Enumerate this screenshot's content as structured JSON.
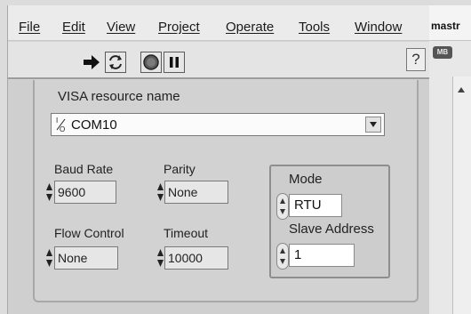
{
  "menu": {
    "file": "File",
    "edit": "Edit",
    "view": "View",
    "project": "Project",
    "operate": "Operate",
    "tools": "Tools",
    "window": "Window"
  },
  "toolbar": {
    "run_icon": "run-arrow-icon",
    "run_continuous_icon": "run-continuously-icon",
    "abort_icon": "abort-execution-icon",
    "pause_icon": "pause-icon",
    "help_label": "?"
  },
  "side_panel": {
    "title": "mastr",
    "badge": "MB"
  },
  "visa": {
    "label": "VISA resource name",
    "prefix": "I/O",
    "value": "COM10"
  },
  "baud_rate": {
    "label": "Baud Rate",
    "value": "9600"
  },
  "parity": {
    "label": "Parity",
    "value": "None"
  },
  "flow_control": {
    "label": "Flow Control",
    "value": "None"
  },
  "timeout": {
    "label": "Timeout",
    "value": "10000"
  },
  "mode": {
    "label": "Mode",
    "value": "RTU"
  },
  "slave_address": {
    "label": "Slave Address",
    "value": "1"
  }
}
